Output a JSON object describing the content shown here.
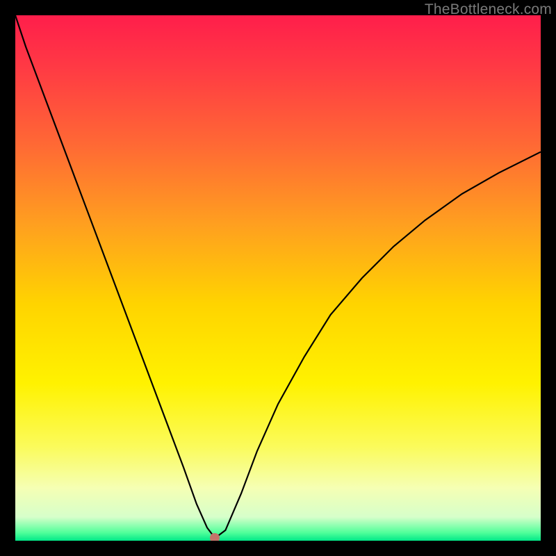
{
  "watermark": "TheBottleneck.com",
  "colors": {
    "frame": "#000000",
    "marker": "#c4746a",
    "curve": "#000000",
    "gradient_stops": [
      {
        "offset": 0.0,
        "color": "#ff1e4b"
      },
      {
        "offset": 0.1,
        "color": "#ff3a44"
      },
      {
        "offset": 0.25,
        "color": "#ff6a34"
      },
      {
        "offset": 0.4,
        "color": "#ffa01f"
      },
      {
        "offset": 0.55,
        "color": "#ffd400"
      },
      {
        "offset": 0.7,
        "color": "#fff200"
      },
      {
        "offset": 0.82,
        "color": "#fbfb5a"
      },
      {
        "offset": 0.9,
        "color": "#f5ffb4"
      },
      {
        "offset": 0.955,
        "color": "#d6ffca"
      },
      {
        "offset": 0.985,
        "color": "#4fff9a"
      },
      {
        "offset": 1.0,
        "color": "#00e888"
      }
    ]
  },
  "chart_data": {
    "type": "line",
    "title": "",
    "xlabel": "",
    "ylabel": "",
    "xlim": [
      0,
      100
    ],
    "ylim": [
      0,
      100
    ],
    "grid": false,
    "legend": false,
    "series": [
      {
        "name": "bottleneck-curve",
        "x": [
          0,
          2,
          5,
          8,
          11,
          14,
          17,
          20,
          23,
          26,
          29,
          32,
          34.5,
          36.5,
          38,
          40,
          43,
          46,
          50,
          55,
          60,
          66,
          72,
          78,
          85,
          92,
          100
        ],
        "y": [
          100,
          94,
          86,
          78,
          70,
          62,
          54,
          46,
          38,
          30,
          22,
          14,
          7,
          2.5,
          0.5,
          2,
          9,
          17,
          26,
          35,
          43,
          50,
          56,
          61,
          66,
          70,
          74
        ]
      }
    ],
    "marker": {
      "x": 38,
      "y": 0.5
    },
    "annotations": [
      {
        "text": "TheBottleneck.com",
        "position": "top-right"
      }
    ]
  }
}
